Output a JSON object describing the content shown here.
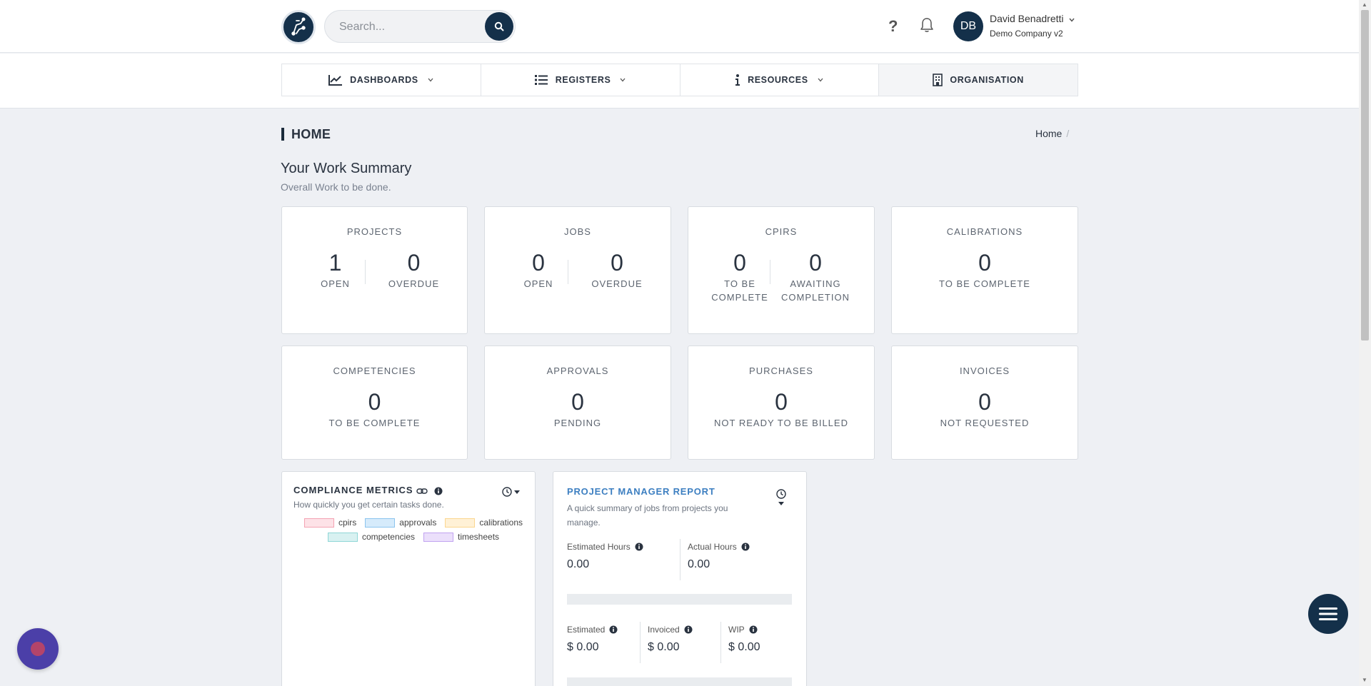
{
  "header": {
    "search_placeholder": "Search...",
    "help_label": "?",
    "user_initials": "DB",
    "user_name": "David Benadretti",
    "company": "Demo Company v2"
  },
  "nav": [
    {
      "label": "DASHBOARDS",
      "icon": "chart-line-icon"
    },
    {
      "label": "REGISTERS",
      "icon": "list-icon"
    },
    {
      "label": "RESOURCES",
      "icon": "info-icon"
    },
    {
      "label": "ORGANISATION",
      "icon": "building-icon"
    }
  ],
  "page": {
    "title": "HOME",
    "breadcrumb": "Home",
    "breadcrumb_sep": "/",
    "summary_title": "Your Work Summary",
    "summary_sub": "Overall Work to be done."
  },
  "cards": {
    "projects": {
      "title": "PROJECTS",
      "a_num": "1",
      "a_lbl": "OPEN",
      "b_num": "0",
      "b_lbl": "OVERDUE"
    },
    "jobs": {
      "title": "JOBS",
      "a_num": "0",
      "a_lbl": "OPEN",
      "b_num": "0",
      "b_lbl": "OVERDUE"
    },
    "cpirs": {
      "title": "CPIRS",
      "a_num": "0",
      "a_lbl1": "TO BE",
      "a_lbl2": "COMPLETE",
      "b_num": "0",
      "b_lbl1": "AWAITING",
      "b_lbl2": "COMPLETION"
    },
    "calibrations": {
      "title": "CALIBRATIONS",
      "num": "0",
      "lbl": "TO BE COMPLETE"
    },
    "competencies": {
      "title": "COMPETENCIES",
      "num": "0",
      "lbl": "TO BE COMPLETE"
    },
    "approvals": {
      "title": "APPROVALS",
      "num": "0",
      "lbl": "PENDING"
    },
    "purchases": {
      "title": "PURCHASES",
      "num": "0",
      "lbl": "NOT READY TO BE BILLED"
    },
    "invoices": {
      "title": "INVOICES",
      "num": "0",
      "lbl": "NOT REQUESTED"
    }
  },
  "compliance": {
    "title": "COMPLIANCE METRICS",
    "sub": "How quickly you get certain tasks done.",
    "legend": [
      {
        "label": "cpirs",
        "fill": "#fde2e7",
        "border": "#f4a3b3"
      },
      {
        "label": "approvals",
        "fill": "#d6ebfb",
        "border": "#8cc4ee"
      },
      {
        "label": "calibrations",
        "fill": "#fff1d6",
        "border": "#fbd690"
      },
      {
        "label": "competencies",
        "fill": "#d8f1f1",
        "border": "#8fd6d6"
      },
      {
        "label": "timesheets",
        "fill": "#ebdffb",
        "border": "#c1a3f0"
      }
    ]
  },
  "pm_report": {
    "title": "PROJECT MANAGER REPORT",
    "sub": "A quick summary of jobs from projects you manage.",
    "estimated_hours_label": "Estimated Hours",
    "estimated_hours": "0.00",
    "actual_hours_label": "Actual Hours",
    "actual_hours": "0.00",
    "estimated_label": "Estimated",
    "estimated": "$ 0.00",
    "invoiced_label": "Invoiced",
    "invoiced": "$ 0.00",
    "wip_label": "WIP",
    "wip": "$ 0.00"
  },
  "colors": {
    "brand_dark": "#14304a",
    "link_blue": "#3d7fc1",
    "background": "#eef0f4"
  }
}
